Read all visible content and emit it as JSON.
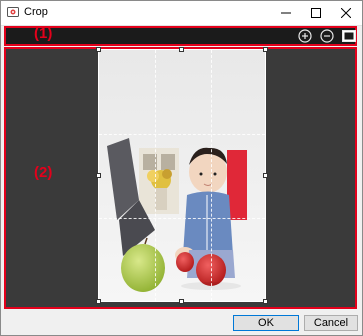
{
  "window": {
    "title": "Crop",
    "controls": {
      "minimize": "—",
      "maximize": "☐",
      "close": "✕"
    }
  },
  "callouts": {
    "toolbar": "(1)",
    "preview": "(2)"
  },
  "toolbar": {
    "zoom_in_icon": "plus-circle",
    "zoom_out_icon": "minus-circle",
    "fit_icon": "fit-window"
  },
  "preview": {
    "photo_subject": "Toddler with apples"
  },
  "footer": {
    "ok_label": "OK",
    "cancel_label": "Cancel"
  },
  "colors": {
    "callout_red": "#e3001b",
    "toolbar_bg": "#1b1b1b",
    "canvas_bg": "#3a3a3a",
    "focus_blue": "#0078d7"
  }
}
